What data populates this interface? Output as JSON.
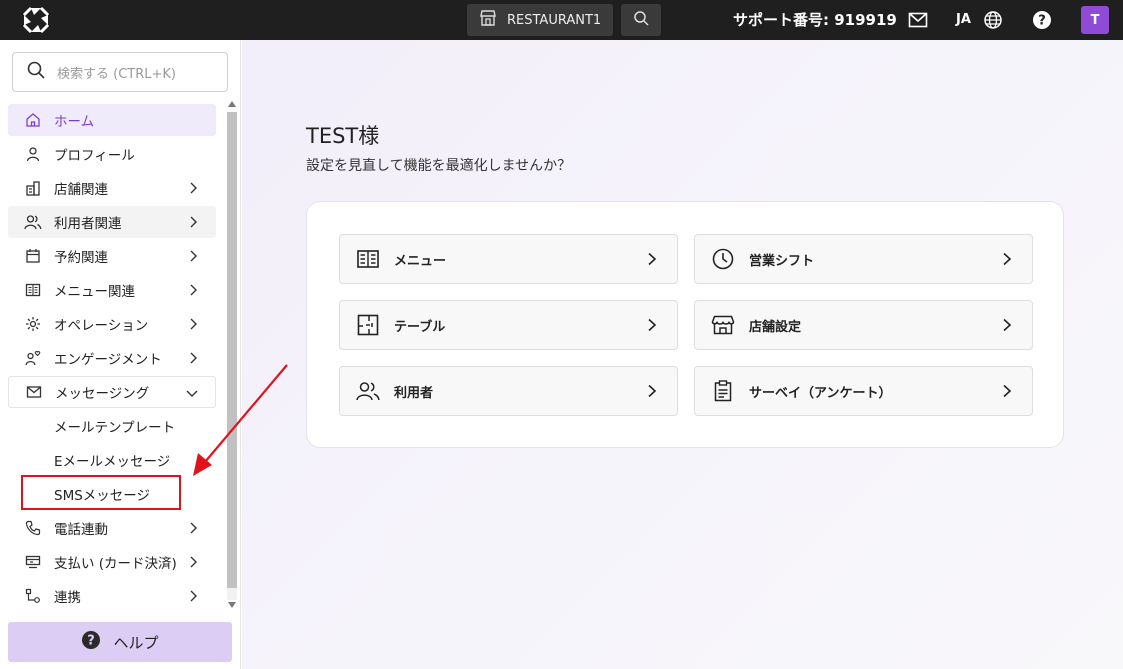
{
  "topbar": {
    "store_name": "RESTAURANT1",
    "support_text": "サポート番号: 919919",
    "lang": "JA",
    "avatar_letter": "T"
  },
  "sidebar": {
    "search_placeholder": "検索する (CTRL+K)",
    "items": [
      {
        "label": "ホーム",
        "icon": "home-icon"
      },
      {
        "label": "プロフィール",
        "icon": "user-icon"
      },
      {
        "label": "店舗関連",
        "icon": "store-building-icon"
      },
      {
        "label": "利用者関連",
        "icon": "users-icon"
      },
      {
        "label": "予約関連",
        "icon": "calendar-icon"
      },
      {
        "label": "メニュー関連",
        "icon": "menu-book-icon"
      },
      {
        "label": "オペレーション",
        "icon": "gear-icon"
      },
      {
        "label": "エンゲージメント",
        "icon": "engagement-icon"
      },
      {
        "label": "メッセージング",
        "icon": "mail-icon"
      },
      {
        "label": "電話連動",
        "icon": "phone-icon"
      },
      {
        "label": "支払い (カード決済)",
        "icon": "payment-icon"
      },
      {
        "label": "連携",
        "icon": "integration-icon"
      }
    ],
    "sub_items": [
      "メールテンプレート",
      "Eメールメッセージ",
      "SMSメッセージ"
    ],
    "help_label": "ヘルプ"
  },
  "main": {
    "greeting": "TEST様",
    "subtitle": "設定を見直して機能を最適化しませんか？",
    "tiles": [
      {
        "label": "メニュー",
        "icon": "menu-book-icon"
      },
      {
        "label": "営業シフト",
        "icon": "clock-icon"
      },
      {
        "label": "テーブル",
        "icon": "table-layout-icon"
      },
      {
        "label": "店舗設定",
        "icon": "storefront-icon"
      },
      {
        "label": "利用者",
        "icon": "users-icon"
      },
      {
        "label": "サーベイ（アンケート）",
        "icon": "clipboard-icon"
      }
    ]
  },
  "colors": {
    "accent": "#7a3fc9",
    "highlight": "#e0121c",
    "topbar": "#1f1f1f"
  }
}
